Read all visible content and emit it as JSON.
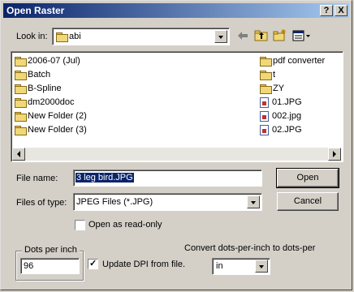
{
  "window": {
    "title": "Open Raster",
    "help": "?",
    "close": "X"
  },
  "lookin": {
    "label": "Look in:",
    "value": "abi"
  },
  "files": {
    "col1": [
      "2006-07 (Jul)",
      "Batch",
      "B-Spline",
      "dm2000doc",
      "New Folder (2)",
      "New Folder (3)"
    ],
    "col2": [
      {
        "name": "pdf converter",
        "type": "folder"
      },
      {
        "name": "t",
        "type": "folder"
      },
      {
        "name": "ZY",
        "type": "folder"
      },
      {
        "name": "01.JPG",
        "type": "jpg"
      },
      {
        "name": "002.jpg",
        "type": "jpg"
      },
      {
        "name": "02.JPG",
        "type": "jpg"
      }
    ]
  },
  "filename": {
    "label": "File name:",
    "value": "3 leg bird.JPG"
  },
  "filetype": {
    "label": "Files of type:",
    "value": "JPEG Files (*.JPG)"
  },
  "buttons": {
    "open": "Open",
    "cancel": "Cancel"
  },
  "readonly": {
    "label": "Open as read-only",
    "checked": false
  },
  "dpi": {
    "group_label": "Dots per inch",
    "value": "96"
  },
  "update_dpi": {
    "label": "Update DPI from file.",
    "checked": true
  },
  "convert": {
    "label": "Convert dots-per-inch to dots-per",
    "value": "in"
  }
}
